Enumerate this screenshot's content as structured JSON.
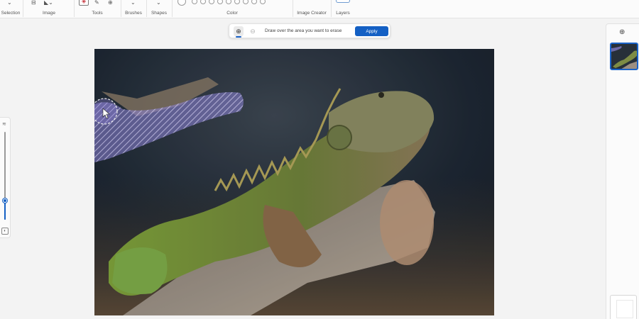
{
  "ribbon": {
    "groups": [
      "Selection",
      "Image",
      "Tools",
      "Brushes",
      "Shapes",
      "Color",
      "Image Creator",
      "Layers"
    ]
  },
  "erase_toolbar": {
    "instruction": "Draw over the area you want to erase",
    "apply_label": "Apply",
    "icons": {
      "add_mode": "plus-circle-icon",
      "remove_mode": "minus-circle-icon"
    }
  },
  "brush_size_slider": {
    "value_fraction": 0.22
  },
  "canvas": {
    "image_subject": "iguana-photo"
  },
  "layers_panel": {
    "add_icon": "plus-circle-icon"
  },
  "colors": {
    "accent": "#1460c4",
    "selection_stroke": "#8c82d6"
  }
}
